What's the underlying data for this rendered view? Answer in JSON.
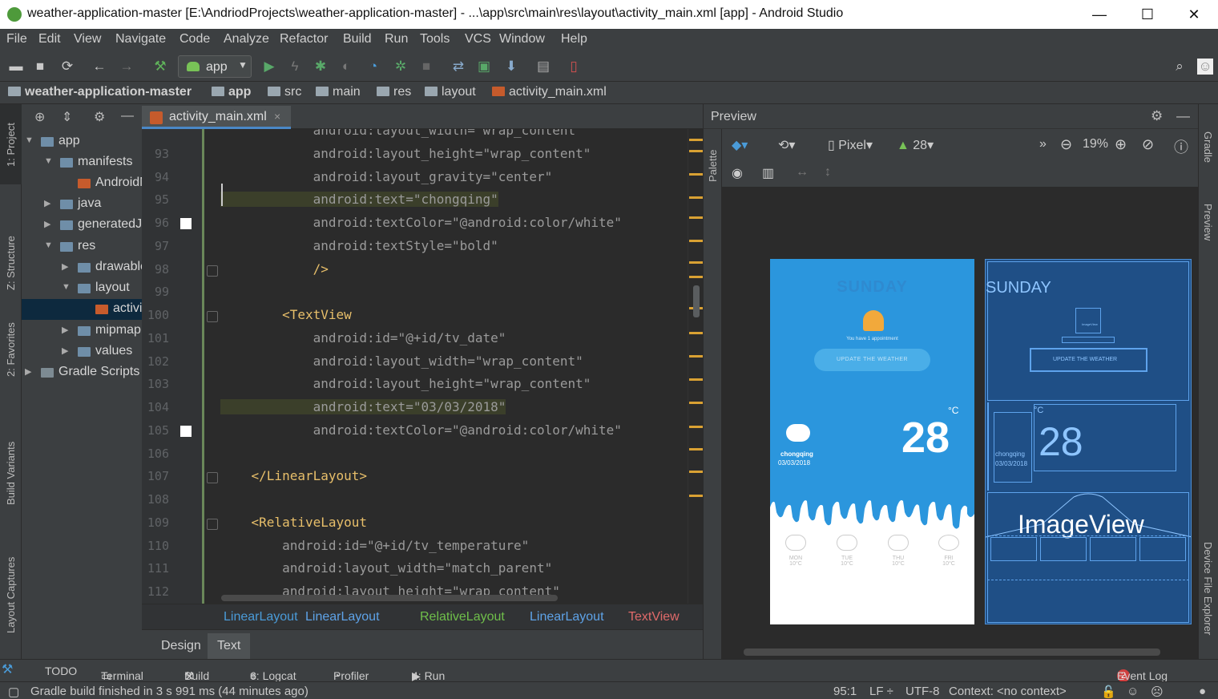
{
  "window": {
    "title": "weather-application-master [E:\\AndriodProjects\\weather-application-master] - ...\\app\\src\\main\\res\\layout\\activity_main.xml [app] - Android Studio",
    "min": "—",
    "max": "☐",
    "close": "✕"
  },
  "menu": [
    "File",
    "Edit",
    "View",
    "Navigate",
    "Code",
    "Analyze",
    "Refactor",
    "Build",
    "Run",
    "Tools",
    "VCS",
    "Window",
    "Help"
  ],
  "toolbar": {
    "run_config": "app"
  },
  "breadcrumb": [
    "weather-application-master",
    "app",
    "src",
    "main",
    "res",
    "layout",
    "activity_main.xml"
  ],
  "left_stripe": [
    "1: Project",
    "Z: Structure",
    "2: Favorites",
    "Build Variants",
    "Layout Captures"
  ],
  "project_tree": [
    {
      "label": "app",
      "depth": 0,
      "arrow": "▼"
    },
    {
      "label": "manifests",
      "depth": 1,
      "arrow": "▼"
    },
    {
      "label": "AndroidManifest.xml",
      "depth": 2,
      "arrow": ""
    },
    {
      "label": "java",
      "depth": 1,
      "arrow": "▶"
    },
    {
      "label": "generatedJava",
      "depth": 1,
      "arrow": "▶"
    },
    {
      "label": "res",
      "depth": 1,
      "arrow": "▼"
    },
    {
      "label": "drawable",
      "depth": 2,
      "arrow": "▶"
    },
    {
      "label": "layout",
      "depth": 2,
      "arrow": "▼"
    },
    {
      "label": "activity_main.xml",
      "depth": 3,
      "arrow": ""
    },
    {
      "label": "mipmap",
      "depth": 2,
      "arrow": "▶"
    },
    {
      "label": "values",
      "depth": 2,
      "arrow": "▶"
    },
    {
      "label": "Gradle Scripts",
      "depth": 0,
      "arrow": "▶"
    }
  ],
  "editor": {
    "tab": "activity_main.xml",
    "close": "×",
    "lines": [
      {
        "n": "",
        "text": "            android:layout_width=\"wrap_content\""
      },
      {
        "n": "93",
        "text": "            android:layout_height=\"wrap_content\""
      },
      {
        "n": "94",
        "text": "            android:layout_gravity=\"center\""
      },
      {
        "n": "95",
        "text": "            android:text=\"chongqing\""
      },
      {
        "n": "96",
        "text": "            android:textColor=\"@android:color/white\""
      },
      {
        "n": "97",
        "text": "            android:textStyle=\"bold\""
      },
      {
        "n": "98",
        "text": "            />"
      },
      {
        "n": "99",
        "text": ""
      },
      {
        "n": "100",
        "text": "        <TextView"
      },
      {
        "n": "101",
        "text": "            android:id=\"@+id/tv_date\""
      },
      {
        "n": "102",
        "text": "            android:layout_width=\"wrap_content\""
      },
      {
        "n": "103",
        "text": "            android:layout_height=\"wrap_content\""
      },
      {
        "n": "104",
        "text": "            android:text=\"03/03/2018\""
      },
      {
        "n": "105",
        "text": "            android:textColor=\"@android:color/white\""
      },
      {
        "n": "106",
        "text": ""
      },
      {
        "n": "107",
        "text": "    </LinearLayout>"
      },
      {
        "n": "108",
        "text": ""
      },
      {
        "n": "109",
        "text": "    <RelativeLayout"
      },
      {
        "n": "110",
        "text": "        android:id=\"@+id/tv_temperature\""
      },
      {
        "n": "111",
        "text": "        android:layout_width=\"match_parent\""
      },
      {
        "n": "112",
        "text": "        android:layout_height=\"wrap_content\""
      }
    ],
    "crumbs": [
      "LinearLayout",
      "LinearLayout",
      "RelativeLayout",
      "LinearLayout",
      "TextView"
    ],
    "modes": [
      "Design",
      "Text"
    ]
  },
  "preview": {
    "title": "Preview",
    "palette": "Palette",
    "device": "Pixel",
    "api": "28",
    "zoom": "19%",
    "app": {
      "day": "SUNDAY",
      "appointment": "You have 1 appointment",
      "update_button": "UPDATE THE WEATHER",
      "unit": "°C",
      "temperature": "28",
      "city": "chongqing",
      "date": "03/03/2018",
      "forecast": [
        {
          "day": "MON",
          "temp": "10°C"
        },
        {
          "day": "TUE",
          "temp": "10°C"
        },
        {
          "day": "THU",
          "temp": "10°C"
        },
        {
          "day": "FRI",
          "temp": "10°C"
        }
      ]
    },
    "blueprint": {
      "day": "SUNDAY",
      "imageview": "ImageView",
      "update_button": "UPDATE THE WEATHER",
      "temperature": "28",
      "unit": "°C",
      "city": "chongqing",
      "date": "03/03/2018",
      "big_imageview": "ImageView"
    }
  },
  "right_stripe": [
    "Gradle",
    "Preview",
    "Device File Explorer"
  ],
  "bottom_tools": [
    "TODO",
    "Terminal",
    "Build",
    "6: Logcat",
    "Profiler",
    "4: Run"
  ],
  "event_log": {
    "count": "2",
    "label": "Event Log"
  },
  "status": {
    "message": "Gradle build finished in 3 s 991 ms (44 minutes ago)",
    "position": "95:1",
    "line_sep": "LF ÷",
    "encoding": "UTF-8",
    "context": "Context: <no context>"
  },
  "colors": {
    "accent": "#4a88c7",
    "sky": "#2b96dd",
    "blueprint": "#1f4f86",
    "attr_value": "#6a8759",
    "tag": "#e8bf6a"
  }
}
